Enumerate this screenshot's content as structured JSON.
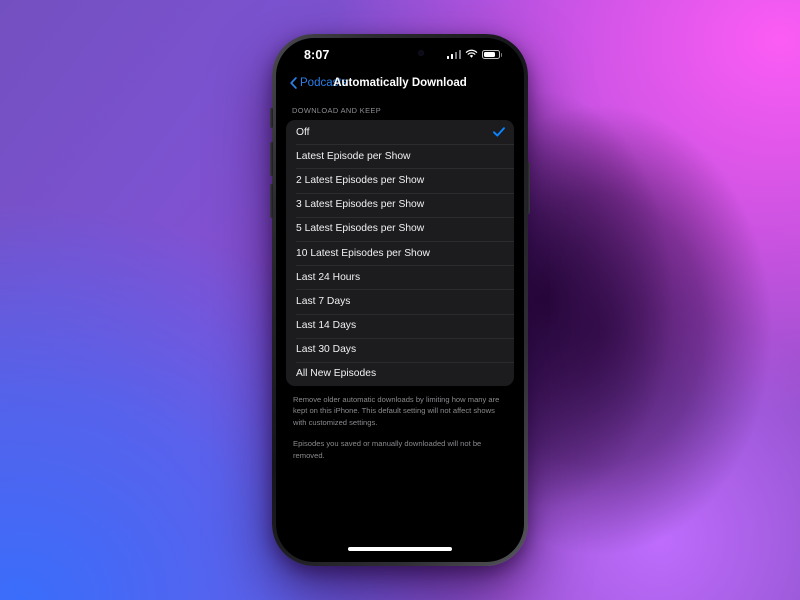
{
  "wallpaper": {
    "gradient_from": "#7350c0",
    "gradient_magenta": "#f456f0",
    "gradient_blue": "#3a6dfb",
    "gradient_violet": "#c06eff"
  },
  "theme": {
    "accent_blue": "#2a7fe8",
    "checkmark_blue": "#0a84ff",
    "list_background": "#1c1c1e",
    "separator": "#2c2c2e",
    "primary_text": "#f2f2f5",
    "secondary_text": "#8a8a8e"
  },
  "status_bar": {
    "time": "8:07",
    "signal_icon": "cellular-signal-icon",
    "wifi_icon": "wifi-icon",
    "battery_icon": "battery-icon",
    "battery_level": 62
  },
  "nav": {
    "back_icon": "chevron-left-icon",
    "back_label": "Podcasts",
    "title": "Automatically Download"
  },
  "section": {
    "header": "DOWNLOAD AND KEEP",
    "selected_index": 0,
    "checkmark_icon": "checkmark-icon",
    "options": [
      {
        "label": "Off"
      },
      {
        "label": "Latest Episode per Show"
      },
      {
        "label": "2 Latest Episodes per Show"
      },
      {
        "label": "3 Latest Episodes per Show"
      },
      {
        "label": "5 Latest Episodes per Show"
      },
      {
        "label": "10 Latest Episodes per Show"
      },
      {
        "label": "Last 24 Hours"
      },
      {
        "label": "Last 7 Days"
      },
      {
        "label": "Last 14 Days"
      },
      {
        "label": "Last 30 Days"
      },
      {
        "label": "All New Episodes"
      }
    ]
  },
  "footer": {
    "paragraph_1": "Remove older automatic downloads by limiting how many are kept on this iPhone. This default setting will not affect shows with customized settings.",
    "paragraph_2": "Episodes you saved or manually downloaded will not be removed."
  },
  "home_indicator": "home-indicator"
}
